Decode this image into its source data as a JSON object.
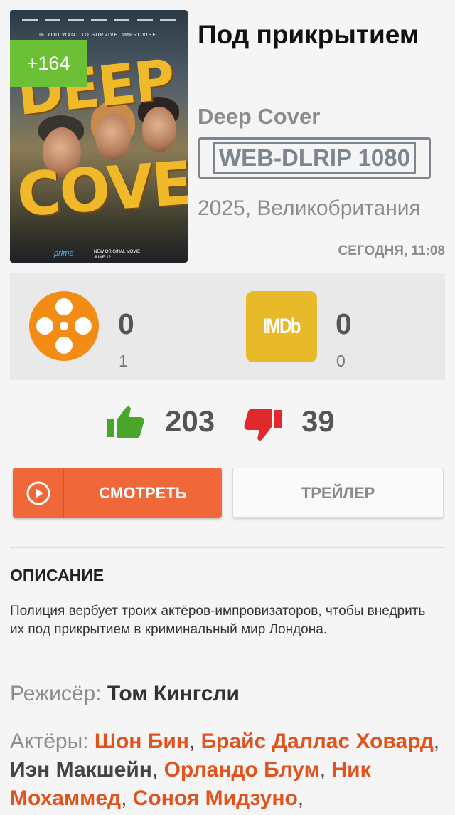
{
  "poster": {
    "tagline": "IF YOU WANT TO SURVIVE, IMPROVISE.",
    "title_line1": "DEEP",
    "title_line2": "COVER",
    "service": "prime",
    "note_line1": "NEW ORIGINAL MOVIE",
    "note_line2": "JUNE 12",
    "badge": "+164"
  },
  "movie": {
    "title": "Под прикрытием",
    "original_title": "Deep Cover",
    "quality": "WEB-DLRIP 1080",
    "year_country": "2025, Великобритания",
    "added": "СЕГОДНЯ, 11:08"
  },
  "ratings": {
    "kinopoisk_icon": "film-reel-icon",
    "kinopoisk_score": "0",
    "kinopoisk_votes": "1",
    "imdb_label": "IMDb",
    "imdb_score": "0",
    "imdb_votes": "0"
  },
  "votes": {
    "likes": "203",
    "dislikes": "39",
    "like_color": "#4aa52b",
    "dislike_color": "#e0282d"
  },
  "buttons": {
    "watch": "СМОТРЕТЬ",
    "trailer": "ТРЕЙЛЕР"
  },
  "description": {
    "heading": "ОПИСАНИЕ",
    "text": "Полиция вербует троих актёров-импровизаторов, чтобы внедрить их под прикрытием в криминальный мир Лондона."
  },
  "director": {
    "label": "Режисёр:",
    "name": "Том Кингсли"
  },
  "actors": {
    "label": "Актёры:",
    "list": [
      {
        "name": "Шон Бин",
        "linked": true
      },
      {
        "name": "Брайс Даллас Ховард",
        "linked": true
      },
      {
        "name": "Иэн Макшейн",
        "linked": false
      },
      {
        "name": "Орландо Блум",
        "linked": true
      },
      {
        "name": "Ник Мохаммед",
        "linked": true
      },
      {
        "name": "Соноя Мидзуно",
        "linked": true
      }
    ]
  },
  "colors": {
    "accent": "#f0673a",
    "badge": "#6cc036",
    "link": "#e0531c",
    "muted": "#8c8c8c"
  }
}
